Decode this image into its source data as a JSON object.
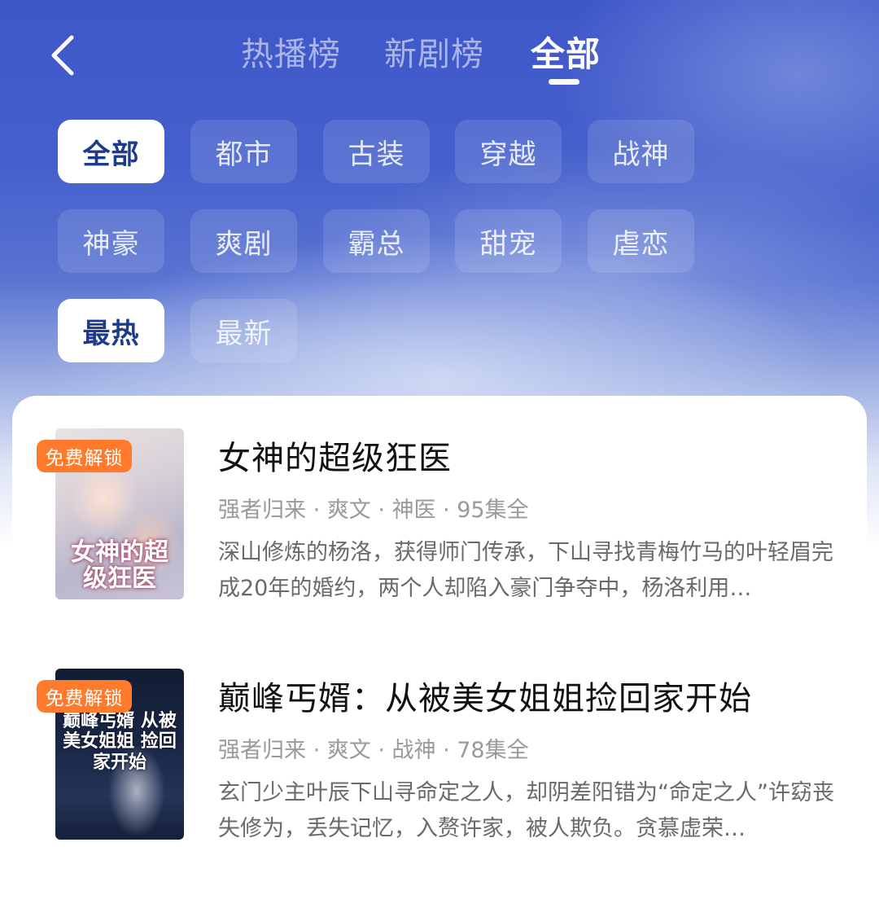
{
  "header": {
    "tabs": [
      {
        "label": "热播榜",
        "active": false
      },
      {
        "label": "新剧榜",
        "active": false
      },
      {
        "label": "全部",
        "active": true
      }
    ]
  },
  "genre_filters": [
    {
      "label": "全部",
      "active": true
    },
    {
      "label": "都市",
      "active": false
    },
    {
      "label": "古装",
      "active": false
    },
    {
      "label": "穿越",
      "active": false
    },
    {
      "label": "战神",
      "active": false
    },
    {
      "label": "神豪",
      "active": false
    },
    {
      "label": "爽剧",
      "active": false
    },
    {
      "label": "霸总",
      "active": false
    },
    {
      "label": "甜宠",
      "active": false
    },
    {
      "label": "虐恋",
      "active": false
    }
  ],
  "sort_filters": [
    {
      "label": "最热",
      "active": true
    },
    {
      "label": "最新",
      "active": false
    }
  ],
  "list": [
    {
      "title": "女神的超级狂医",
      "meta": "强者归来 · 爽文 · 神医 · 95集全",
      "description": "深山修炼的杨洛，获得师门传承，下山寻找青梅竹马的叶轻眉完成20年的婚约，两个人却陷入豪门争夺中，杨洛利用…",
      "badge": "免费解锁",
      "cover_text": "女神的超级狂医"
    },
    {
      "title": "巅峰丐婿：从被美女姐姐捡回家开始",
      "meta": "强者归来 · 爽文 · 战神 · 78集全",
      "description": "玄门少主叶辰下山寻命定之人，却阴差阳错为“命定之人”许窈丧失修为，丢失记忆，入赘许家，被人欺负。贪慕虚荣…",
      "badge": "免费解锁",
      "cover_text": "巅峰丐婿 从被美女姐姐 捡回家开始"
    }
  ],
  "colors": {
    "accent_blue": "#1d3a8f",
    "badge_orange": "#ff7a2a"
  }
}
